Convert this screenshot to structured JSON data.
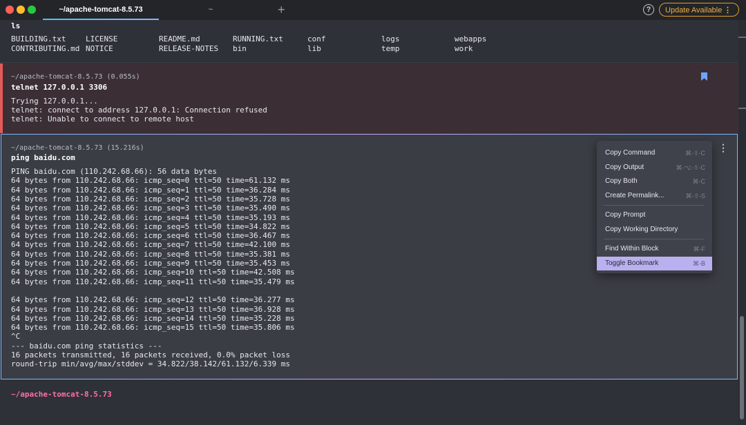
{
  "tabs": [
    {
      "label": "~/apache-tomcat-8.5.73"
    },
    {
      "label": "~"
    }
  ],
  "new_tab_glyph": "+",
  "help_glyph": "?",
  "update_label": "Update Available",
  "update_menu_glyph": "⋮",
  "ls_block": {
    "command": "ls",
    "rows": [
      [
        "BUILDING.txt",
        "LICENSE",
        "README.md",
        "RUNNING.txt",
        "conf",
        "logs",
        "webapps"
      ],
      [
        "CONTRIBUTING.md",
        "NOTICE",
        "RELEASE-NOTES",
        "bin",
        "lib",
        "temp",
        "work"
      ]
    ]
  },
  "err_block": {
    "meta": "~/apache-tomcat-8.5.73 (0.055s)",
    "command": "telnet 127.0.0.1 3306",
    "output": [
      "Trying 127.0.0.1...",
      "telnet: connect to address 127.0.0.1: Connection refused",
      "telnet: Unable to connect to remote host"
    ]
  },
  "ping_block": {
    "meta": "~/apache-tomcat-8.5.73 (15.216s)",
    "command": "ping baidu.com",
    "output": [
      "PING baidu.com (110.242.68.66): 56 data bytes",
      "64 bytes from 110.242.68.66: icmp_seq=0 ttl=50 time=61.132 ms",
      "64 bytes from 110.242.68.66: icmp_seq=1 ttl=50 time=36.284 ms",
      "64 bytes from 110.242.68.66: icmp_seq=2 ttl=50 time=35.728 ms",
      "64 bytes from 110.242.68.66: icmp_seq=3 ttl=50 time=35.490 ms",
      "64 bytes from 110.242.68.66: icmp_seq=4 ttl=50 time=35.193 ms",
      "64 bytes from 110.242.68.66: icmp_seq=5 ttl=50 time=34.822 ms",
      "64 bytes from 110.242.68.66: icmp_seq=6 ttl=50 time=36.467 ms",
      "64 bytes from 110.242.68.66: icmp_seq=7 ttl=50 time=42.100 ms",
      "64 bytes from 110.242.68.66: icmp_seq=8 ttl=50 time=35.381 ms",
      "64 bytes from 110.242.68.66: icmp_seq=9 ttl=50 time=35.453 ms",
      "64 bytes from 110.242.68.66: icmp_seq=10 ttl=50 time=42.508 ms",
      "64 bytes from 110.242.68.66: icmp_seq=11 ttl=50 time=35.479 ms",
      "",
      "64 bytes from 110.242.68.66: icmp_seq=12 ttl=50 time=36.277 ms",
      "64 bytes from 110.242.68.66: icmp_seq=13 ttl=50 time=36.928 ms",
      "64 bytes from 110.242.68.66: icmp_seq=14 ttl=50 time=35.228 ms",
      "64 bytes from 110.242.68.66: icmp_seq=15 ttl=50 time=35.806 ms",
      "^C",
      "--- baidu.com ping statistics ---",
      "16 packets transmitted, 16 packets received, 0.0% packet loss",
      "round-trip min/avg/max/stddev = 34.822/38.142/61.132/6.339 ms"
    ]
  },
  "context_menu": {
    "groups": [
      [
        {
          "label": "Copy Command",
          "shortcut": "⌘-⇧-C"
        },
        {
          "label": "Copy Output",
          "shortcut": "⌘-⌥-⇧-C"
        },
        {
          "label": "Copy Both",
          "shortcut": "⌘-C"
        },
        {
          "label": "Create Permalink...",
          "shortcut": "⌘-⇧-S"
        }
      ],
      [
        {
          "label": "Copy Prompt",
          "shortcut": ""
        },
        {
          "label": "Copy Working Directory",
          "shortcut": ""
        }
      ],
      [
        {
          "label": "Find Within Block",
          "shortcut": "⌘-F"
        },
        {
          "label": "Toggle Bookmark",
          "shortcut": "⌘-B",
          "selected": true
        }
      ]
    ]
  },
  "current_prompt": "~/apache-tomcat-8.5.73",
  "colors": {
    "accent": "#b9b0f0",
    "error_bar": "#e35a5a",
    "prompt": "#ff6fa8",
    "update": "#f0b040"
  }
}
